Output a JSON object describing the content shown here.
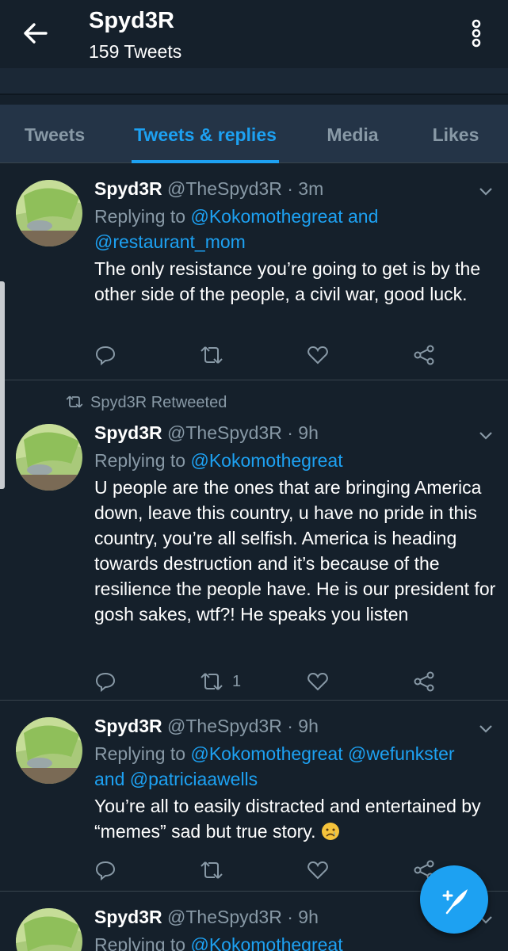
{
  "header": {
    "title": "Spyd3R",
    "subtitle": "159 Tweets"
  },
  "tabs": [
    {
      "label": "Tweets"
    },
    {
      "label": "Tweets & replies"
    },
    {
      "label": "Media"
    },
    {
      "label": "Likes"
    }
  ],
  "tweets": [
    {
      "name": "Spyd3R",
      "handle": "@TheSpyd3R · 3m",
      "reply_prefix": "Replying to ",
      "reply_m1": "@Kokomothegreat",
      "reply_mid": " and",
      "reply_m2": "@restaurant_mom",
      "text": "The only resistance you’re going to get is by the other side of the people, a civil war, good luck."
    },
    {
      "retweet_note": "Spyd3R Retweeted",
      "name": "Spyd3R",
      "handle": "@TheSpyd3R · 9h",
      "reply_prefix": "Replying to ",
      "reply_m1": "@Kokomothegreat",
      "text": "U people are the ones that are bringing America down, leave this country, u have no pride in this country, you’re all selfish. America is heading towards destruction and it’s because of the resilience the people have. He is our president for gosh sakes, wtf?! He speaks you listen",
      "retweet_count": "1"
    },
    {
      "name": "Spyd3R",
      "handle": "@TheSpyd3R · 9h",
      "reply_prefix": "Replying to ",
      "reply_m1": "@Kokomothegreat",
      "reply_m2": "@wefunkster",
      "reply_mid": "and ",
      "reply_m3": "@patriciaawells",
      "text": "You’re all to easily distracted and entertained by “memes” sad but true story.",
      "emoji": "crying-face"
    },
    {
      "name": "Spyd3R",
      "handle": "@TheSpyd3R · 9h",
      "reply_prefix": "Replying to ",
      "reply_m1": "@Kokomothegreat"
    }
  ],
  "icons": {
    "back": "arrow-left-icon",
    "menu": "more-vertical-icon",
    "reply": "comment-icon",
    "retweet": "retweet-icon",
    "like": "heart-icon",
    "share": "share-icon",
    "compose": "compose-tweet-icon"
  },
  "colors": {
    "background": "#15202b",
    "tabs_bg": "#243447",
    "accent": "#1da1f2",
    "muted": "#8899a6"
  }
}
